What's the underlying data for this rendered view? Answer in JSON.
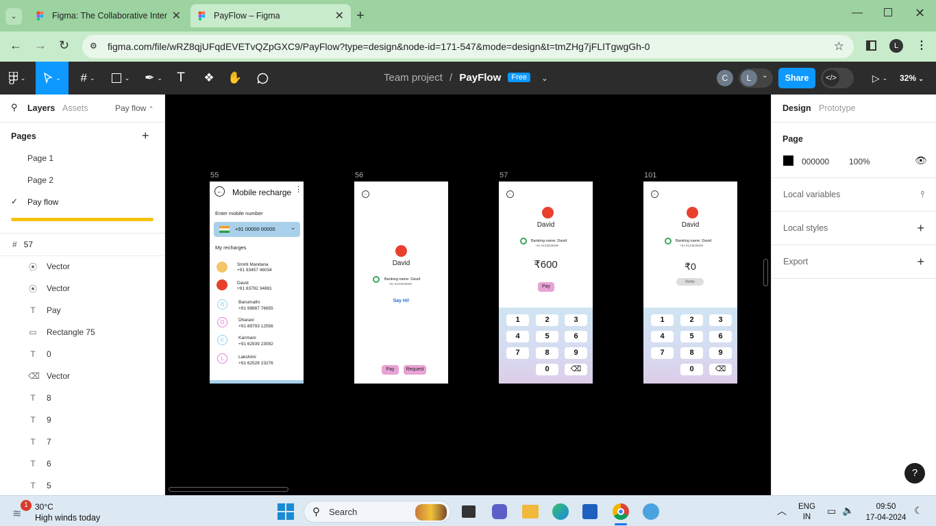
{
  "browser": {
    "tabs": [
      {
        "title": "Figma: The Collaborative Inter"
      },
      {
        "title": "PayFlow – Figma"
      }
    ],
    "url": "figma.com/file/wRZ8qjUFqdEVETvQZpGXC9/PayFlow?type=design&node-id=171-547&mode=design&t=tmZHg7jFLITgwgGh-0"
  },
  "figma": {
    "project": "Team project",
    "file": "PayFlow",
    "plan_badge": "Free",
    "avatars": [
      "C",
      "L"
    ],
    "share_label": "Share",
    "zoom": "32%"
  },
  "left_panel": {
    "tabs": [
      "Layers",
      "Assets"
    ],
    "page_dropdown": "Pay flow",
    "pages_title": "Pages",
    "pages": [
      "Page 1",
      "Page 2",
      "Pay flow"
    ],
    "selected_frame": "57",
    "layers": [
      {
        "icon": "vector-node-icon",
        "name": "Vector"
      },
      {
        "icon": "vector-node-icon",
        "name": "Vector"
      },
      {
        "icon": "text-icon",
        "name": "Pay"
      },
      {
        "icon": "rectangle-icon",
        "name": "Rectangle 75"
      },
      {
        "icon": "text-icon",
        "name": "0"
      },
      {
        "icon": "backspace-icon",
        "name": "Vector"
      },
      {
        "icon": "text-icon",
        "name": "8"
      },
      {
        "icon": "text-icon",
        "name": "9"
      },
      {
        "icon": "text-icon",
        "name": "7"
      },
      {
        "icon": "text-icon",
        "name": "6"
      },
      {
        "icon": "text-icon",
        "name": "5"
      }
    ]
  },
  "right_panel": {
    "tabs": [
      "Design",
      "Prototype"
    ],
    "page_section": "Page",
    "bg_hex": "000000",
    "bg_opacity": "100%",
    "sections": [
      "Local variables",
      "Local styles",
      "Export"
    ],
    "help": "?"
  },
  "canvas": {
    "frames": [
      {
        "label": "55",
        "title": "Mobile recharge",
        "input_label": "Enter mobile number",
        "phone_value": "+91 00000 00000",
        "list_title": "My recharges",
        "contacts": [
          {
            "initial": "",
            "name": "Smriti Mandana",
            "number": "+91 93457 46034"
          },
          {
            "initial": "",
            "name": "David",
            "number": "+91 63792 34891"
          },
          {
            "initial": "B",
            "name": "Banumathi",
            "number": "+91 99887 76655"
          },
          {
            "initial": "D",
            "name": "Dharani",
            "number": "+91 89793 12556"
          },
          {
            "initial": "K",
            "name": "Kanmani",
            "number": "+91 62939 23092"
          },
          {
            "initial": "L",
            "name": "Lakshimi",
            "number": "+91 62528 23276"
          }
        ]
      },
      {
        "label": "56",
        "name": "David",
        "banking": "Banking name: David",
        "number": "+91 9133849838",
        "say_hi": "Say Hi!",
        "pay": "Pay",
        "request": "Request"
      },
      {
        "label": "57",
        "name": "David",
        "banking": "Banking name: David",
        "number": "+91 9133849838",
        "amount": "₹600",
        "pay": "Pay",
        "keys": [
          "1",
          "2",
          "3",
          "4",
          "5",
          "6",
          "7",
          "8",
          "9",
          "0"
        ]
      },
      {
        "label": "101",
        "name": "David",
        "banking": "Banking name: David",
        "number": "+91 9133849838",
        "amount": "₹0",
        "note": "Note",
        "keys": [
          "1",
          "2",
          "3",
          "4",
          "5",
          "6",
          "7",
          "8",
          "9",
          "0"
        ]
      }
    ]
  },
  "taskbar": {
    "weather_temp": "30°C",
    "weather_desc": "High winds today",
    "weather_badge": "1",
    "search": "Search",
    "lang_top": "ENG",
    "lang_bottom": "IN",
    "time": "09:50",
    "date": "17-04-2024"
  },
  "colors": {
    "browser_tab_bg": "#9cd3a0",
    "toolbar_bg": "#2c2c2c",
    "accent_blue": "#0d99ff",
    "canvas_bg": "#000000",
    "pay_pink": "#e9a2d5"
  }
}
